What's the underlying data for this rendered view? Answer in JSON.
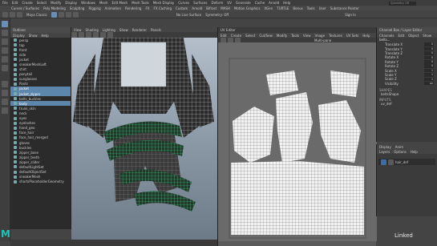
{
  "menubar": [
    "File",
    "Edit",
    "Create",
    "Select",
    "Modify",
    "Display",
    "Windows",
    "Mesh",
    "Edit Mesh",
    "Mesh Tools",
    "Mesh Display",
    "Curves",
    "Surfaces",
    "Deform",
    "UV",
    "Generate",
    "Cache",
    "Arnold",
    "Help"
  ],
  "search_placeholder": "Symmetry: Off",
  "shelf_tabs": [
    "Curves / Surfaces",
    "Poly Modeling",
    "Sculpting",
    "Rigging",
    "Animation",
    "Rendering",
    "FX",
    "FX Caching",
    "Custom",
    "Arnold",
    "Bifrost",
    "MASH",
    "Motion Graphics",
    "XGen",
    "TURTLE",
    "Bonus",
    "Tools",
    "User",
    "Substance Painter"
  ],
  "status": {
    "workspace": "Maya Classic",
    "live_surface": "No Live Surface",
    "symmetry": "Symmetry: Off",
    "sign_in": "Sign In"
  },
  "outliner": {
    "title": "Outliner",
    "menu": [
      "Display",
      "Show",
      "Help"
    ],
    "items": [
      {
        "label": "persp",
        "selected": false
      },
      {
        "label": "top",
        "selected": false
      },
      {
        "label": "front",
        "selected": false
      },
      {
        "label": "side",
        "selected": false
      },
      {
        "label": "jacket",
        "selected": false
      },
      {
        "label": "sneakerMeshLeft",
        "selected": false
      },
      {
        "label": "shirt",
        "selected": false
      },
      {
        "label": "ponytail",
        "selected": false
      },
      {
        "label": "sunglasses",
        "selected": false
      },
      {
        "label": "Pants",
        "selected": false
      },
      {
        "label": "jacket",
        "selected": true
      },
      {
        "label": "jacket_zipper",
        "selected": true
      },
      {
        "label": "belts_buckles",
        "selected": false
      },
      {
        "label": "body",
        "selected": true
      },
      {
        "label": "trunk_skin",
        "selected": false
      },
      {
        "label": "neck",
        "selected": false
      },
      {
        "label": "eyes",
        "selected": false
      },
      {
        "label": "eyelashes",
        "selected": false
      },
      {
        "label": "hand_geo",
        "selected": false
      },
      {
        "label": "face_hair",
        "selected": false
      },
      {
        "label": "face_hair_merged",
        "selected": false
      },
      {
        "label": "gloves",
        "selected": false
      },
      {
        "label": "buckles",
        "selected": false
      },
      {
        "label": "zipper_base",
        "selected": false
      },
      {
        "label": "zipper_teeth",
        "selected": false
      },
      {
        "label": "zipper_slider",
        "selected": false
      },
      {
        "label": "defaultLightSet",
        "selected": false
      },
      {
        "label": "defaultObjectSet",
        "selected": false
      },
      {
        "label": "sneakerMesh",
        "selected": false
      },
      {
        "label": "shortsPlaceholderGeometry",
        "selected": false
      }
    ]
  },
  "viewport": {
    "menu": [
      "View",
      "Shading",
      "Lighting",
      "Show",
      "Renderer",
      "Panels"
    ]
  },
  "uv_editor": {
    "title": "UV Editor",
    "menu": [
      "Edit",
      "Create",
      "Select",
      "Cut/Sew",
      "Modify",
      "Tools",
      "View",
      "Image",
      "Textures",
      "UV Sets",
      "Help"
    ],
    "layout": "Multi-pane"
  },
  "channel_box": {
    "title": "Channel Box / Layer Editor",
    "menu": [
      "Channels",
      "Edit",
      "Object",
      "Show"
    ],
    "object": "belts...",
    "attributes": [
      {
        "name": "Translate X",
        "value": "0"
      },
      {
        "name": "Translate Y",
        "value": "0"
      },
      {
        "name": "Translate Z",
        "value": "0"
      },
      {
        "name": "Rotate X",
        "value": "0"
      },
      {
        "name": "Rotate Y",
        "value": "0"
      },
      {
        "name": "Rotate Z",
        "value": "0"
      },
      {
        "name": "Scale X",
        "value": "1"
      },
      {
        "name": "Scale Y",
        "value": "1"
      },
      {
        "name": "Scale Z",
        "value": "1"
      },
      {
        "name": "Visibility",
        "value": "on"
      }
    ],
    "shapes_label": "SHAPES",
    "shape_name": "beltsShape",
    "inputs_label": "INPUTS",
    "input_name": "uv_def"
  },
  "layers": {
    "tabs": [
      "Display",
      "Anim"
    ],
    "menu": [
      "Layers",
      "Options",
      "Help"
    ],
    "layer_name": "hair_def"
  },
  "watermark": "Linked",
  "colors": {
    "selection": "#5d86ad",
    "wire_highlight": "#2de08a",
    "logo": "#22c3b8"
  }
}
